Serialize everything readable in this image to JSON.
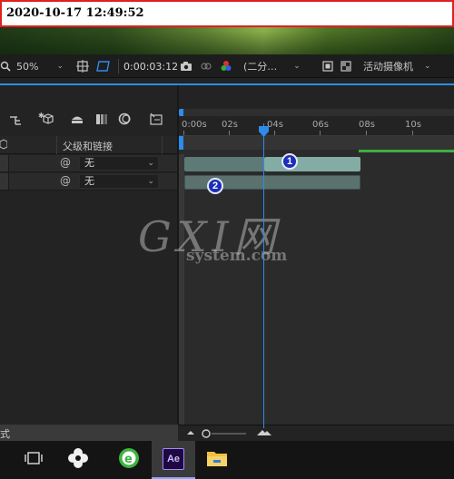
{
  "screenshot_timestamp": "2020-10-17  12:49:52",
  "comp_toolbar": {
    "zoom": "50%",
    "timecode": "0:00:03:12",
    "resolution": "(二分…",
    "camera": "活动摄像机"
  },
  "columns": {
    "parent_link": "父级和链接"
  },
  "layers": [
    {
      "parent": "无",
      "badge": "1"
    },
    {
      "parent": "无",
      "badge": "2"
    }
  ],
  "ruler": {
    "ticks": [
      "0:00s",
      "02s",
      "04s",
      "06s",
      "08s",
      "10s"
    ],
    "current_time": "3.5s"
  },
  "watermark": {
    "big": "GXI网",
    "small": "system.com"
  },
  "bottom_left_text": "式",
  "accent_color": "#2d8ceb",
  "taskbar": {
    "apps": [
      "task-view",
      "pinwheel-app",
      "360-browser",
      "after-effects",
      "file-explorer"
    ],
    "active": "after-effects",
    "ae_label": "Ae"
  }
}
